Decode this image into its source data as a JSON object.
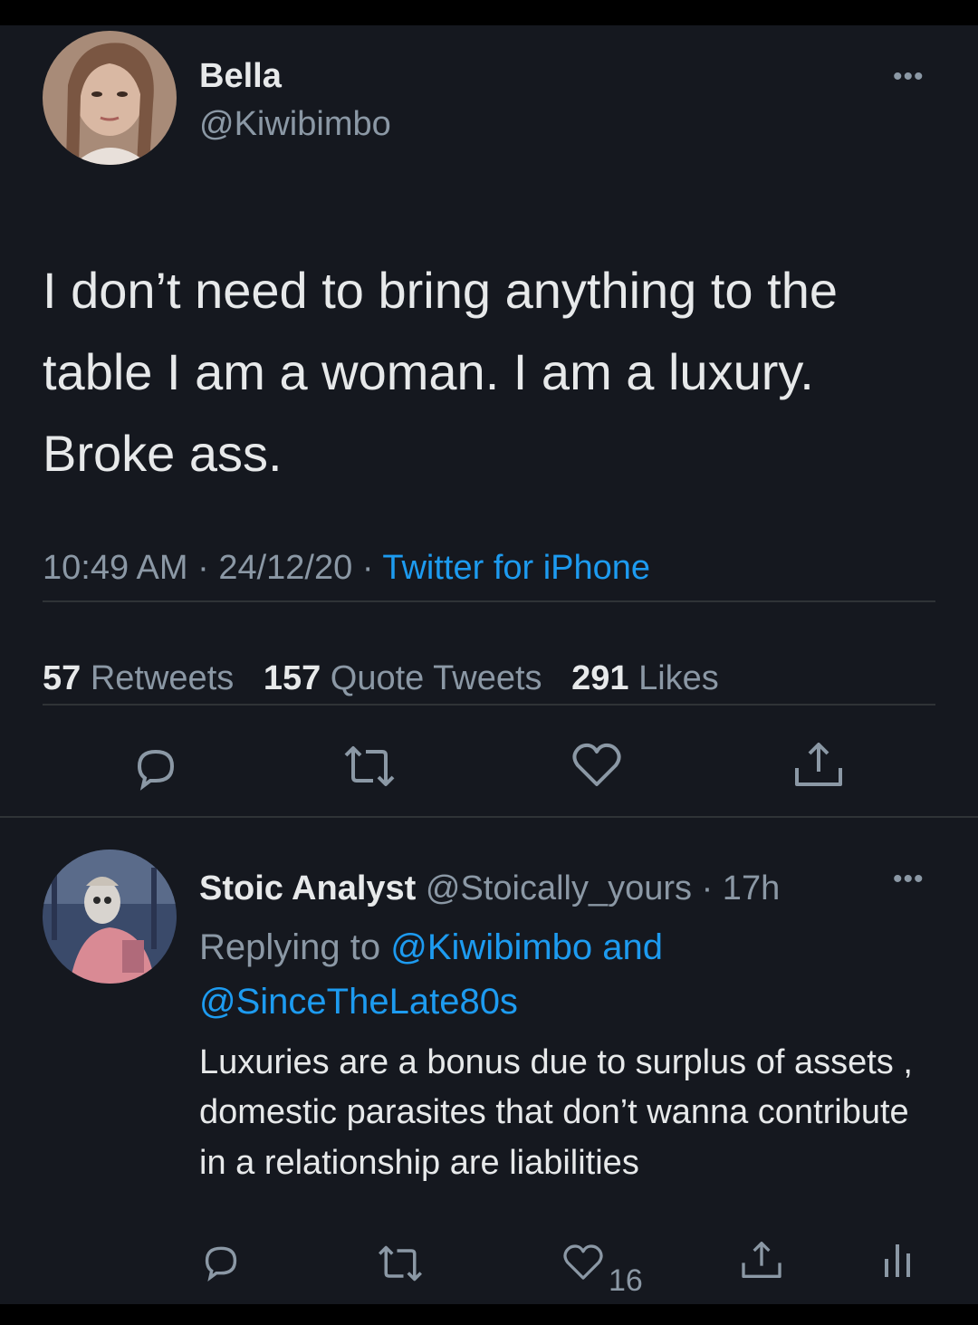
{
  "tweet": {
    "author_name": "Bella",
    "author_handle": "@Kiwibimbo",
    "text": "I don’t need to bring anything to the table I am a woman. I am a luxury. Broke ass.",
    "time": "10:49 AM",
    "date": "24/12/20",
    "separator": "·",
    "source": "Twitter for iPhone",
    "stats": {
      "retweets_count": "57",
      "retweets_label": "Retweets",
      "quotes_count": "157",
      "quotes_label": "Quote Tweets",
      "likes_count": "291",
      "likes_label": "Likes"
    },
    "more_icon": "ellipsis-icon",
    "actions": [
      "reply-icon",
      "retweet-icon",
      "like-icon",
      "share-icon"
    ]
  },
  "reply": {
    "author_name": "Stoic Analyst",
    "author_handle": "@Stoically_yours",
    "age": "· 17h",
    "replying_prefix": "Replying to",
    "replying_to_1": "@Kiwibimbo",
    "replying_conj": "and",
    "replying_to_2": "@SinceTheLate80s",
    "text": "Luxuries are a bonus due to surplus of assets , domestic parasites that don’t wanna contribute in a relationship are liabilities",
    "likes_count": "16",
    "actions": [
      "reply-icon",
      "retweet-icon",
      "like-icon",
      "share-icon",
      "analytics-icon"
    ]
  },
  "colors": {
    "background": "#15181f",
    "text": "#e7e9ea",
    "muted": "#8b98a5",
    "link": "#1d9bf0",
    "divider": "#2f3336"
  }
}
